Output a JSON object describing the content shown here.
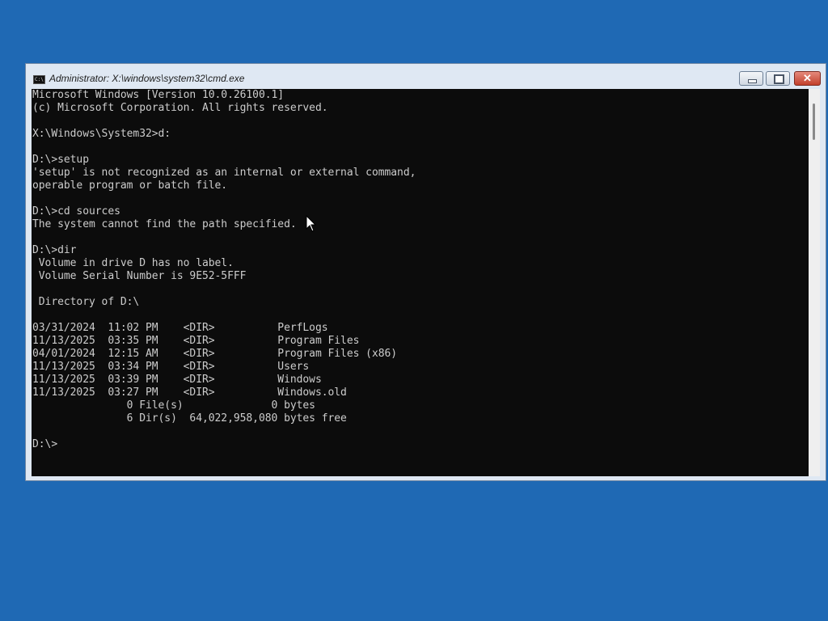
{
  "window": {
    "title": "Administrator: X:\\windows\\system32\\cmd.exe",
    "icon_label": "C:\\",
    "minimize_glyph": "",
    "maximize_glyph": "",
    "close_glyph": "✕"
  },
  "console": {
    "lines": [
      "Microsoft Windows [Version 10.0.26100.1]",
      "(c) Microsoft Corporation. All rights reserved.",
      "",
      "X:\\Windows\\System32>d:",
      "",
      "D:\\>setup",
      "'setup' is not recognized as an internal or external command,",
      "operable program or batch file.",
      "",
      "D:\\>cd sources",
      "The system cannot find the path specified.",
      "",
      "D:\\>dir",
      " Volume in drive D has no label.",
      " Volume Serial Number is 9E52-5FFF",
      "",
      " Directory of D:\\",
      "",
      "03/31/2024  11:02 PM    <DIR>          PerfLogs",
      "11/13/2025  03:35 PM    <DIR>          Program Files",
      "04/01/2024  12:15 AM    <DIR>          Program Files (x86)",
      "11/13/2025  03:34 PM    <DIR>          Users",
      "11/13/2025  03:39 PM    <DIR>          Windows",
      "11/13/2025  03:27 PM    <DIR>          Windows.old",
      "               0 File(s)              0 bytes",
      "               6 Dir(s)  64,022,958,080 bytes free",
      "",
      "D:\\>"
    ]
  },
  "colors": {
    "desktop": "#1f69b4",
    "console_bg": "#0c0c0c",
    "console_fg": "#cccccc",
    "close_button": "#c2402c"
  },
  "icons": [
    "cmd-app-icon",
    "minimize-icon",
    "maximize-icon",
    "close-icon",
    "mouse-pointer-icon"
  ]
}
